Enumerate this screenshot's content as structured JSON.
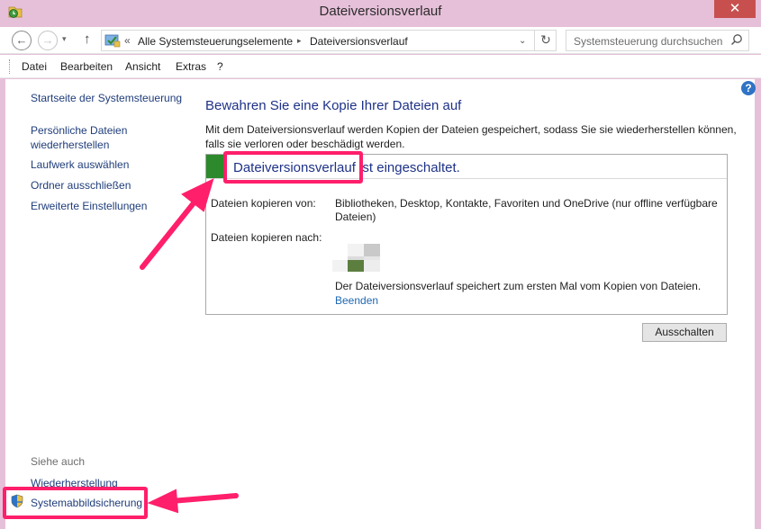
{
  "window": {
    "title": "Dateiversionsverlauf",
    "close_glyph": "✕"
  },
  "nav": {
    "back_glyph": "←",
    "forward_glyph": "→",
    "dropdown_glyph": "▾",
    "up_glyph": "↑"
  },
  "address": {
    "prefix_glyph": "«",
    "crumbs": [
      "Alle Systemsteuerungselemente",
      "Dateiversionsverlauf"
    ],
    "separator_glyph": "▸",
    "dropdown_glyph": "⌄",
    "refresh_glyph": "↻"
  },
  "search": {
    "placeholder": "Systemsteuerung durchsuchen"
  },
  "menu": {
    "items": [
      "Datei",
      "Bearbeiten",
      "Ansicht",
      "Extras",
      "?"
    ]
  },
  "sidebar": {
    "links": [
      "Startseite der Systemsteuerung",
      "Persönliche Dateien wiederherstellen",
      "Laufwerk auswählen",
      "Ordner ausschließen",
      "Erweiterte Einstellungen"
    ],
    "see_also_heading": "Siehe auch",
    "see_also": [
      "Wiederherstellung",
      "Systemabbildsicherung"
    ]
  },
  "help_glyph": "?",
  "main": {
    "title": "Bewahren Sie eine Kopie Ihrer Dateien auf",
    "description": "Mit dem Dateiversionsverlauf werden Kopien der Dateien gespeichert, sodass Sie sie wiederherstellen können, falls sie verloren oder beschädigt werden.",
    "status": "Dateiversionsverlauf ist eingeschaltet.",
    "copy_from_label": "Dateien kopieren von:",
    "copy_from_value": "Bibliotheken, Desktop, Kontakte, Favoriten und OneDrive (nur offline verfügbare Dateien)",
    "copy_to_label": "Dateien kopieren nach:",
    "first_copy_note": "Der Dateiversionsverlauf speichert zum ersten Mal vom Kopien von Dateien.",
    "stop_link": "Beenden",
    "turn_off_button": "Ausschalten"
  },
  "colors": {
    "annotation": "#ff1f6b",
    "status_green": "#2c8a2c",
    "link_blue": "#1f68b3",
    "title_blue": "#1e3287"
  }
}
